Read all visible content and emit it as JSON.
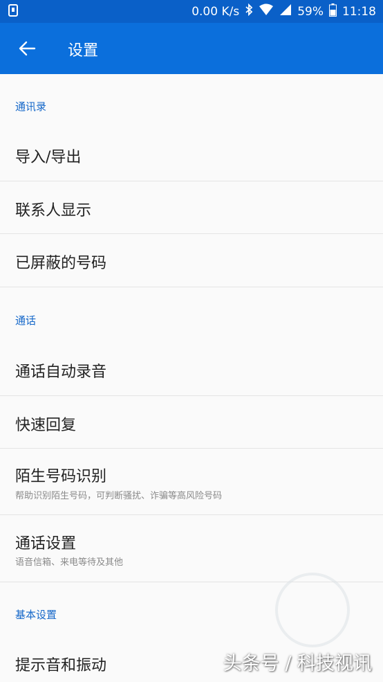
{
  "status_bar": {
    "speed": "0.00 K/s",
    "battery": "59%",
    "time": "11:18"
  },
  "app_bar": {
    "title": "设置"
  },
  "sections": {
    "contacts": {
      "header": "通讯录",
      "items": [
        {
          "title": "导入/导出"
        },
        {
          "title": "联系人显示"
        },
        {
          "title": "已屏蔽的号码"
        }
      ]
    },
    "calls": {
      "header": "通话",
      "items": [
        {
          "title": "通话自动录音"
        },
        {
          "title": "快速回复"
        },
        {
          "title": "陌生号码识别",
          "subtitle": "帮助识别陌生号码，可判断骚扰、诈骗等高风险号码"
        },
        {
          "title": "通话设置",
          "subtitle": "语音信箱、来电等待及其他"
        }
      ]
    },
    "basic": {
      "header": "基本设置",
      "items": [
        {
          "title": "提示音和振动"
        }
      ]
    }
  },
  "watermark": "头条号 / 科技视讯",
  "colors": {
    "status_bar": "#0a60c8",
    "app_bar": "#0b6fdc",
    "section_header": "#1467c9",
    "background": "#fafafa"
  }
}
